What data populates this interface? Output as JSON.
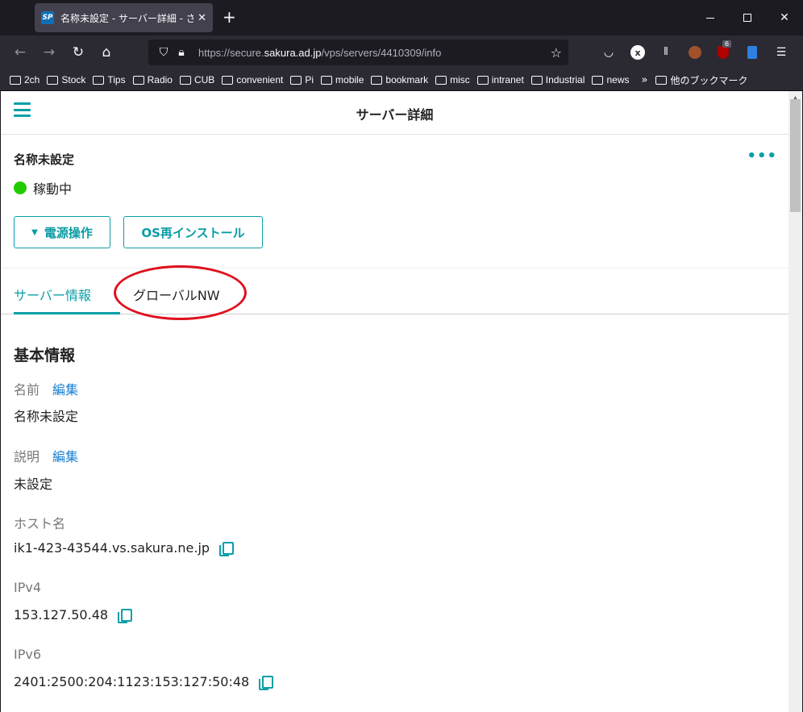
{
  "browser": {
    "tab_title": "名称未設定 - サーバー詳細 - さくらの",
    "tab_favicon_text": "SP",
    "url_prefix": "https://secure.",
    "url_domain": "sakura.ad.jp",
    "url_path": "/vps/servers/4410309/info",
    "ext_badge": "6",
    "bookmarks": [
      "2ch",
      "Stock",
      "Tips",
      "Radio",
      "CUB",
      "convenient",
      "Pi",
      "mobile",
      "bookmark",
      "misc",
      "intranet",
      "Industrial",
      "news"
    ],
    "other_bookmarks": "他のブックマーク"
  },
  "header": {
    "title": "サーバー詳細"
  },
  "server": {
    "name": "名称未設定",
    "status": "稼動中",
    "status_color": "#22cc00",
    "power_button": "電源操作",
    "reinstall_button": "OS再インストール"
  },
  "tabs": [
    {
      "label": "サーバー情報",
      "active": true
    },
    {
      "label": "グローバルNW",
      "active": false
    }
  ],
  "info": {
    "section_title": "基本情報",
    "edit_label": "編集",
    "name_label": "名前",
    "name_value": "名称未設定",
    "desc_label": "説明",
    "desc_value": "未設定",
    "host_label": "ホスト名",
    "host_value": "ik1-423-43544.vs.sakura.ne.jp",
    "ipv4_label": "IPv4",
    "ipv4_value": "153.127.50.48",
    "ipv6_label": "IPv6",
    "ipv6_value": "2401:2500:204:1123:153:127:50:48"
  },
  "accent_color": "#0aa0a8",
  "annotation_color": "#e0101d"
}
